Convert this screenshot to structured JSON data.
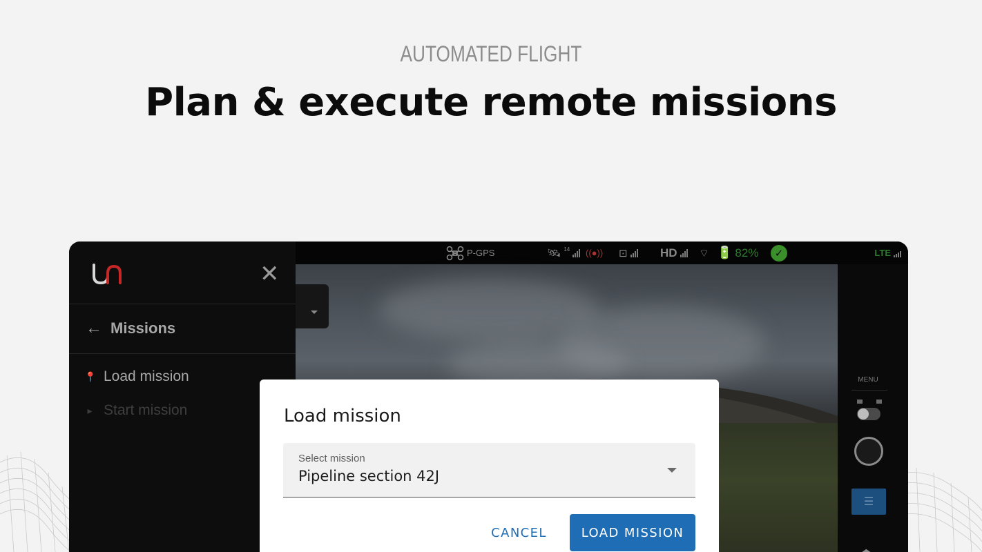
{
  "hero": {
    "eyebrow": "AUTOMATED FLIGHT",
    "headline": "Plan & execute remote missions"
  },
  "statusbar": {
    "flight_mode": "P-GPS",
    "satellites": "14",
    "video_quality": "HD",
    "battery": "82%",
    "network": "LTE"
  },
  "sidebar": {
    "back_label": "Missions",
    "items": [
      {
        "label": "Load mission",
        "icon": "pin-play-icon",
        "enabled": true
      },
      {
        "label": "Start mission",
        "icon": "play-icon",
        "enabled": false
      }
    ]
  },
  "right_panel": {
    "menu_label": "MENU"
  },
  "dialog": {
    "title": "Load mission",
    "select_label": "Select mission",
    "select_value": "Pipeline section 42J",
    "cancel_label": "CANCEL",
    "load_label": "LOAD MISSION"
  },
  "colors": {
    "accent": "#1f6eb5",
    "battery_green": "#2e7d2e",
    "logo_red": "#c62828"
  }
}
